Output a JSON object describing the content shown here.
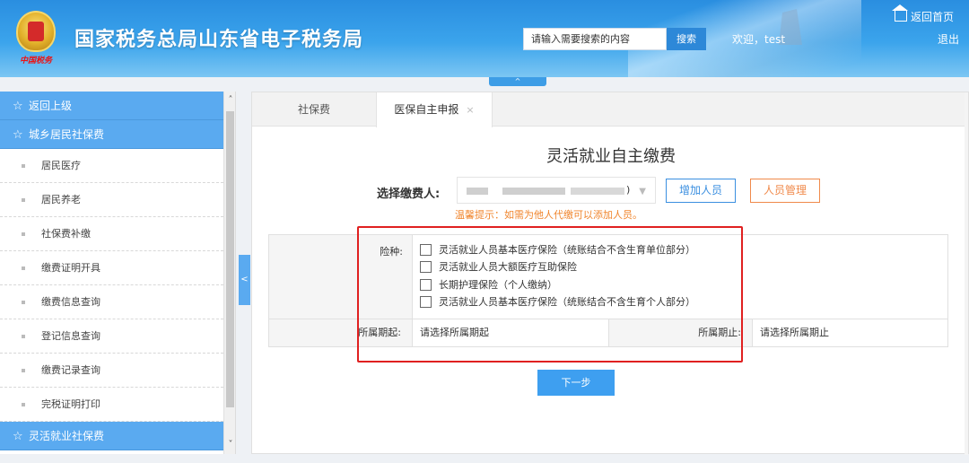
{
  "header": {
    "site_title": "国家税务总局山东省电子税务局",
    "seal_text": "中国税务",
    "search_placeholder": "请输入需要搜索的内容",
    "search_button": "搜索",
    "welcome": "欢迎，test",
    "home_link": "返回首页",
    "logout": "退出",
    "collapse_glyph": "^"
  },
  "sidebar": {
    "back_label": "返回上级",
    "section1_title": "城乡居民社保费",
    "items": [
      "居民医疗",
      "居民养老",
      "社保费补缴",
      "缴费证明开具",
      "缴费信息查询",
      "登记信息查询",
      "缴费记录查询",
      "完税证明打印"
    ],
    "section2_title": "灵活就业社保费",
    "star": "☆",
    "toggle": "<"
  },
  "tabs": [
    {
      "label": "社保费"
    },
    {
      "label": "医保自主申报",
      "close": "×"
    }
  ],
  "form": {
    "title": "灵活就业自主缴费",
    "payer_label": "选择缴费人:",
    "payer_value_suffix": ")",
    "add_person": "增加人员",
    "manage_person": "人员管理",
    "tip": "温馨提示：如需为他人代缴可以添加人员。",
    "insurance_label": "险种:",
    "insurance_options": [
      "灵活就业人员基本医疗保险（统账结合不含生育单位部分）",
      "灵活就业人员大额医疗互助保险",
      "长期护理保险（个人缴纳）",
      "灵活就业人员基本医疗保险（统账结合不含生育个人部分）"
    ],
    "period_start_label": "所属期起:",
    "period_start_placeholder": "请选择所属期起",
    "period_end_label": "所属期止:",
    "period_end_placeholder": "请选择所属期止",
    "next_button": "下一步"
  },
  "colors": {
    "header_blue": "#2a8ee0",
    "sidebar_head": "#5aaaf0",
    "highlight_red": "#e02020",
    "tip_orange": "#f0862e",
    "primary_button": "#3e9ff0"
  }
}
